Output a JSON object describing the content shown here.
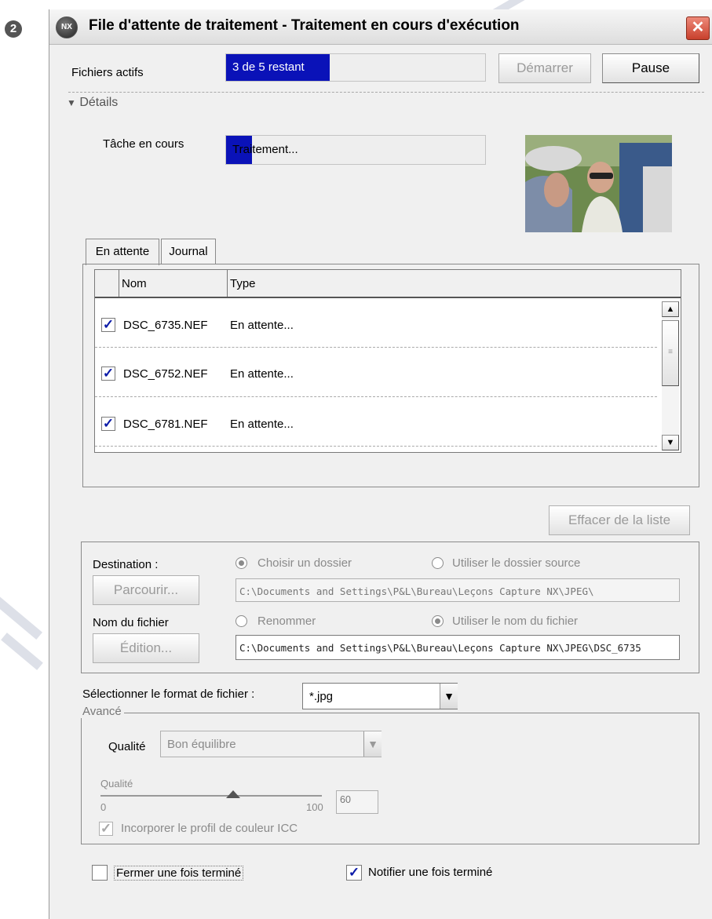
{
  "step_badge": "2",
  "window": {
    "logo_text": "NX",
    "title": "File d'attente de traitement - Traitement en cours d'exécution",
    "close_glyph": "✕"
  },
  "active_files": {
    "label": "Fichiers actifs",
    "progress_text": "3 de 5 restant",
    "progress_fraction": 0.4,
    "start_button": "Démarrer",
    "pause_button": "Pause"
  },
  "details": {
    "toggle_label": "Détails",
    "toggle_icon": "triangle-down-icon",
    "current_task_label": "Tâche en cours",
    "current_task_text": "Traitement...",
    "current_task_fraction": 0.1
  },
  "tabs": [
    {
      "label": "En attente",
      "active": true
    },
    {
      "label": "Journal",
      "active": false
    }
  ],
  "queue": {
    "columns": [
      "Nom",
      "Type"
    ],
    "rows": [
      {
        "checked": true,
        "name": "DSC_6735.NEF",
        "type": "En attente..."
      },
      {
        "checked": true,
        "name": "DSC_6752.NEF",
        "type": "En attente..."
      },
      {
        "checked": true,
        "name": "DSC_6781.NEF",
        "type": "En attente..."
      }
    ]
  },
  "clear_button": "Effacer de la liste",
  "destination": {
    "label": "Destination :",
    "radio_choose": "Choisir un dossier",
    "radio_source": "Utiliser le dossier source",
    "browse_button": "Parcourir...",
    "path": "C:\\Documents and Settings\\P&L\\Bureau\\Leçons Capture NX\\JPEG\\"
  },
  "filename": {
    "label": "Nom du fichier",
    "radio_rename": "Renommer",
    "radio_use": "Utiliser le nom du fichier",
    "edit_button": "Édition...",
    "path": "C:\\Documents and Settings\\P&L\\Bureau\\Leçons Capture NX\\JPEG\\DSC_6735"
  },
  "format": {
    "label": "Sélectionner le format de fichier :",
    "value": "*.jpg"
  },
  "advanced": {
    "legend": "Avancé",
    "quality_label": "Qualité",
    "quality_combo": "Bon équilibre",
    "slider_label": "Qualité",
    "slider_min": "0",
    "slider_max": "100",
    "slider_value": "60",
    "slider_fraction": 0.6,
    "icc_label": "Incorporer le profil de couleur ICC"
  },
  "footer": {
    "close_when_done": "Fermer une fois terminé",
    "notify_when_done": "Notifier une fois terminé"
  },
  "colors": {
    "progress_blue": "#0a12b8",
    "check_blue": "#0b1aa8"
  }
}
